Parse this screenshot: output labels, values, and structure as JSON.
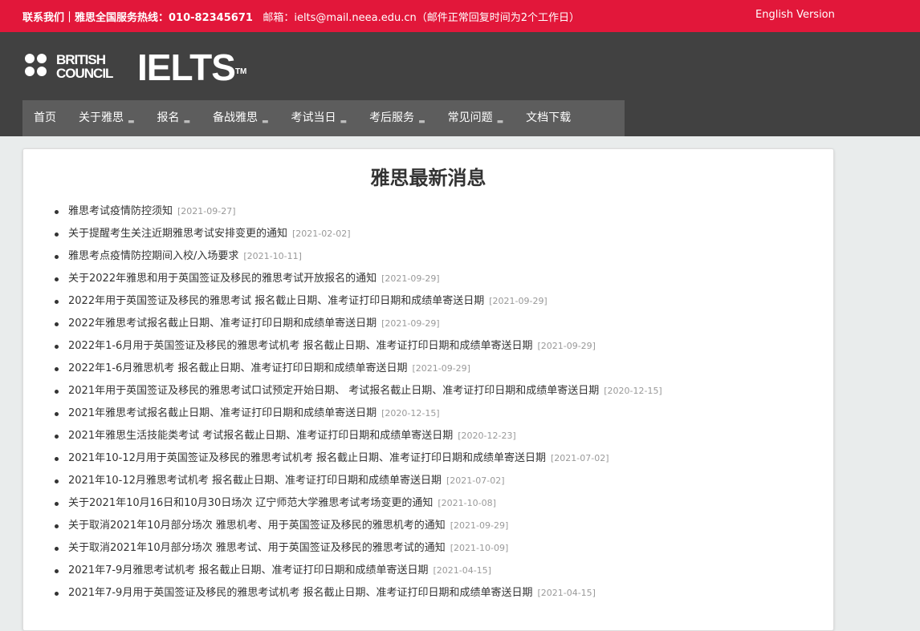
{
  "topbar": {
    "contact_label": "联系我们",
    "hotline": "｜雅思全国服务热线：010-82345671",
    "email": "邮箱：ielts@mail.neea.edu.cn（邮件正常回复时间为2个工作日）",
    "english_link": "English Version"
  },
  "header": {
    "bc_logo_line1": "BRITISH",
    "bc_logo_line2": "COUNCIL",
    "ielts_logo": "IELTS",
    "ielts_tm": "TM"
  },
  "nav": [
    {
      "label": "首页"
    },
    {
      "label": "关于雅思"
    },
    {
      "label": "报名"
    },
    {
      "label": "备战雅思"
    },
    {
      "label": "考试当日"
    },
    {
      "label": "考后服务"
    },
    {
      "label": "常见问题"
    },
    {
      "label": "文档下载"
    }
  ],
  "main": {
    "title": "雅思最新消息",
    "news": [
      {
        "title": "雅思考试疫情防控须知",
        "date": "[2021-09-27]"
      },
      {
        "title": "关于提醒考生关注近期雅思考试安排变更的通知",
        "date": "[2021-02-02]"
      },
      {
        "title": "雅思考点疫情防控期间入校/入场要求",
        "date": "[2021-10-11]"
      },
      {
        "title": "关于2022年雅思和用于英国签证及移民的雅思考试开放报名的通知",
        "date": "[2021-09-29]"
      },
      {
        "title": "2022年用于英国签证及移民的雅思考试 报名截止日期、准考证打印日期和成绩单寄送日期",
        "date": "[2021-09-29]"
      },
      {
        "title": "2022年雅思考试报名截止日期、准考证打印日期和成绩单寄送日期",
        "date": "[2021-09-29]"
      },
      {
        "title": "2022年1-6月用于英国签证及移民的雅思考试机考 报名截止日期、准考证打印日期和成绩单寄送日期",
        "date": "[2021-09-29]"
      },
      {
        "title": "2022年1-6月雅思机考 报名截止日期、准考证打印日期和成绩单寄送日期",
        "date": "[2021-09-29]"
      },
      {
        "title": "2021年用于英国签证及移民的雅思考试口试预定开始日期、 考试报名截止日期、准考证打印日期和成绩单寄送日期",
        "date": "[2020-12-15]"
      },
      {
        "title": "2021年雅思考试报名截止日期、准考证打印日期和成绩单寄送日期",
        "date": "[2020-12-15]"
      },
      {
        "title": "2021年雅思生活技能类考试 考试报名截止日期、准考证打印日期和成绩单寄送日期",
        "date": "[2020-12-23]"
      },
      {
        "title": "2021年10-12月用于英国签证及移民的雅思考试机考 报名截止日期、准考证打印日期和成绩单寄送日期",
        "date": "[2021-07-02]"
      },
      {
        "title": "2021年10-12月雅思考试机考 报名截止日期、准考证打印日期和成绩单寄送日期",
        "date": "[2021-07-02]"
      },
      {
        "title": "关于2021年10月16日和10月30日场次 辽宁师范大学雅思考试考场变更的通知",
        "date": "[2021-10-08]"
      },
      {
        "title": "关于取消2021年10月部分场次 雅思机考、用于英国签证及移民的雅思机考的通知",
        "date": "[2021-09-29]"
      },
      {
        "title": "关于取消2021年10月部分场次 雅思考试、用于英国签证及移民的雅思考试的通知",
        "date": "[2021-10-09]"
      },
      {
        "title": "2021年7-9月雅思考试机考 报名截止日期、准考证打印日期和成绩单寄送日期",
        "date": "[2021-04-15]"
      },
      {
        "title": "2021年7-9月用于英国签证及移民的雅思考试机考 报名截止日期、准考证打印日期和成绩单寄送日期",
        "date": "[2021-04-15]"
      }
    ]
  }
}
